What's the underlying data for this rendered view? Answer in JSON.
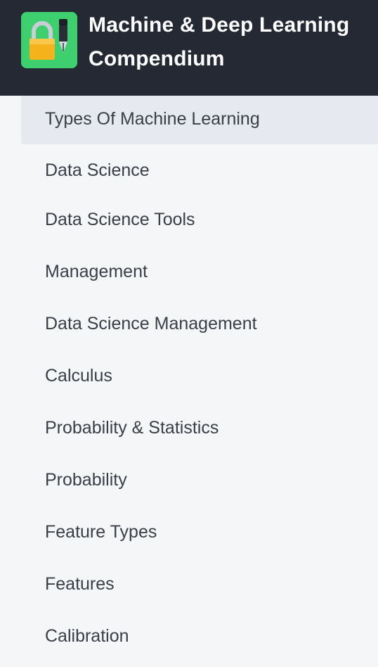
{
  "header": {
    "logo_icon": "padlock-pen-icon",
    "title_line1": "Machine & Deep Learning",
    "title_line2": "Compendium"
  },
  "sidebar": {
    "active_index": 0,
    "items": [
      {
        "label": "Types Of Machine Learning"
      },
      {
        "label": "Data Science"
      },
      {
        "label": "Data Science Tools"
      },
      {
        "label": "Management"
      },
      {
        "label": "Data Science Management"
      },
      {
        "label": "Calculus"
      },
      {
        "label": "Probability & Statistics"
      },
      {
        "label": "Probability"
      },
      {
        "label": "Feature Types"
      },
      {
        "label": "Features"
      },
      {
        "label": "Calibration"
      }
    ]
  },
  "colors": {
    "header_bg": "#242933",
    "logo_bg": "#3ecf6f",
    "active_item_bg": "#e6e9ef",
    "sidebar_bg": "#f5f6f7",
    "text": "#3a3f47"
  }
}
